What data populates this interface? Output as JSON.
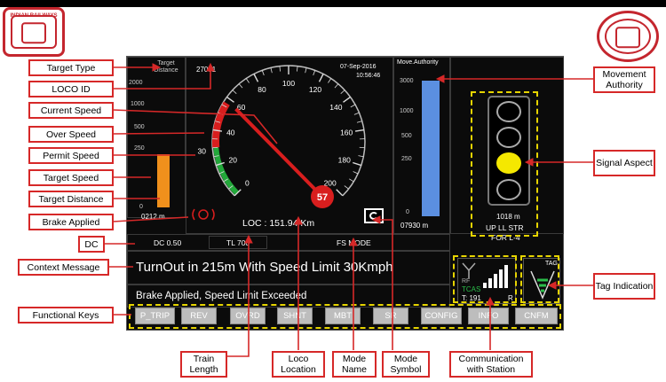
{
  "logos": {
    "left_text": "INDIAN RAILWAYS",
    "right_text": ""
  },
  "labels": {
    "target_type": "Target Type",
    "loco_id": "LOCO ID",
    "current_speed": "Current Speed",
    "over_speed": "Over Speed",
    "permit_speed": "Permit Speed",
    "target_speed": "Target Speed",
    "target_distance": "Target Distance",
    "brake_applied": "Brake Applied",
    "dc": "DC",
    "context_message": "Context Message",
    "functional_keys": "Functional Keys",
    "movement_authority": "Movement Authority",
    "signal_aspect": "Signal Aspect",
    "tag_indication": "Tag Indication",
    "train_length": "Train Length",
    "loco_location": "Loco Location",
    "mode_name": "Mode Name",
    "mode_symbol": "Mode Symbol",
    "communication_with_station": "Communication with Station"
  },
  "screen": {
    "target_distance_title": "Target Distance",
    "target_scale": [
      "2000",
      "1000",
      "500",
      "250",
      "0"
    ],
    "target_distance_value": "0212 m",
    "loco_id": "27001",
    "date": "07-Sep-2016",
    "time": "10:56:46",
    "speedo_ticks": [
      "0",
      "20",
      "40",
      "60",
      "80",
      "100",
      "120",
      "140",
      "160",
      "180",
      "200"
    ],
    "permit_speed_value": "30",
    "current_speed": "57",
    "loco_location": "LOC : 151.94 Km",
    "ma_title": "Move.Authority",
    "ma_scale": [
      "3000",
      "1000",
      "500",
      "250",
      "0"
    ],
    "ma_value": "07930 m",
    "signal_distance": "1018 m",
    "signal_line1": "UP LL STR",
    "signal_line2": "FOR L-4",
    "tcas_label": "TCAS",
    "station_text": "T: 191",
    "station_flag": "R",
    "rf_label": "RF",
    "tag_label": "TAG",
    "dc_value": "DC 0.50",
    "train_length": "TL 700",
    "mode_name": "FS MODE",
    "context_message": "TurnOut in 215m With Speed Limit 30Kmph",
    "status_message": "Brake Applied, Speed Limit Exceeded",
    "function_keys": [
      "P_TRIP",
      "REV",
      "OVRD",
      "SHNT",
      "MBT",
      "SR",
      "CONFIG",
      "INFO",
      "CNFM"
    ]
  },
  "gauge_data": {
    "speed_max": 200,
    "current_speed": 57,
    "permit_speed": 30,
    "target_distance_fraction": 0.42,
    "movement_authority_fraction": 0.93
  },
  "colors": {
    "annotation": "#d62828",
    "highlight": "#e6d400",
    "over_speed": "#d81e1e",
    "permit": "#22a83a",
    "target_bar": "#f0901c",
    "ma_bar": "#5b8fe0",
    "signal_yellow": "#f5e800",
    "function_key": "#bdbdbd"
  }
}
